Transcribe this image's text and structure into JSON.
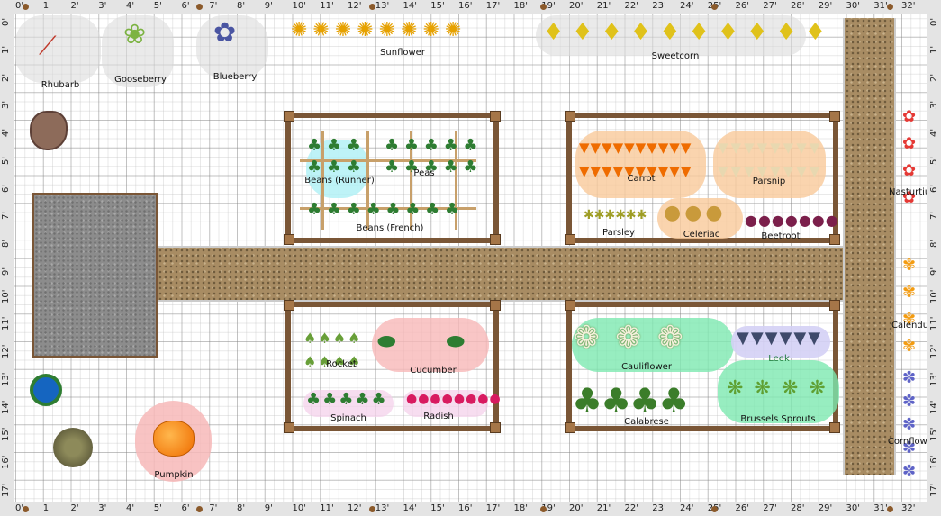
{
  "rulers": {
    "top": [
      "0'",
      "1'",
      "2'",
      "3'",
      "4'",
      "5'",
      "6'",
      "7'",
      "8'",
      "9'",
      "10'",
      "11'",
      "12'",
      "13'",
      "14'",
      "15'",
      "16'",
      "17'",
      "18'",
      "19'",
      "20'",
      "21'",
      "22'",
      "23'",
      "24'",
      "25'",
      "26'",
      "27'",
      "28'",
      "29'",
      "30'",
      "31'",
      "32'"
    ],
    "left": [
      "0'",
      "1'",
      "2'",
      "3'",
      "4'",
      "5'",
      "6'",
      "7'",
      "8'",
      "9'",
      "10'",
      "11'",
      "12'",
      "13'",
      "14'",
      "15'",
      "16'",
      "17'"
    ]
  },
  "labels": {
    "rhubarb": "Rhubarb",
    "gooseberry": "Gooseberry",
    "blueberry": "Blueberry",
    "sunflower": "Sunflower",
    "sweetcorn": "Sweetcorn",
    "beans_runner": "Beans (Runner)",
    "peas": "Peas",
    "beans_french": "Beans (French)",
    "carrot": "Carrot",
    "parsnip": "Parsnip",
    "parsley": "Parsley",
    "celeriac": "Celeriac",
    "beetroot": "Beetroot",
    "nasturtium": "Nasturtium",
    "calendula": "Calendula",
    "cornflower": "Cornflower",
    "rocket": "Rocket",
    "cucumber": "Cucumber",
    "spinach": "Spinach",
    "radish": "Radish",
    "cauliflower": "Cauliflower",
    "leek": "Leek",
    "calabrese": "Calabrese",
    "brussels_sprouts": "Brussels Sprouts",
    "pumpkin": "Pumpkin"
  },
  "colors": {
    "wood": "#7a5636",
    "path": "#a88c63",
    "shed": "#8c8c8c",
    "halo_pink": "#f7b8b8",
    "halo_orange": "#f9c99a",
    "halo_green": "#7de8b0",
    "halo_cyan": "#aef0f5",
    "halo_purple": "#d4d0f5"
  },
  "icons": {
    "sunflower": "sunflower-icon",
    "sweetcorn": "corn-icon",
    "carrot": "carrot-icon",
    "pumpkin": "pumpkin-icon",
    "cauliflower": "cauliflower-icon",
    "calabrese": "broccoli-icon"
  }
}
